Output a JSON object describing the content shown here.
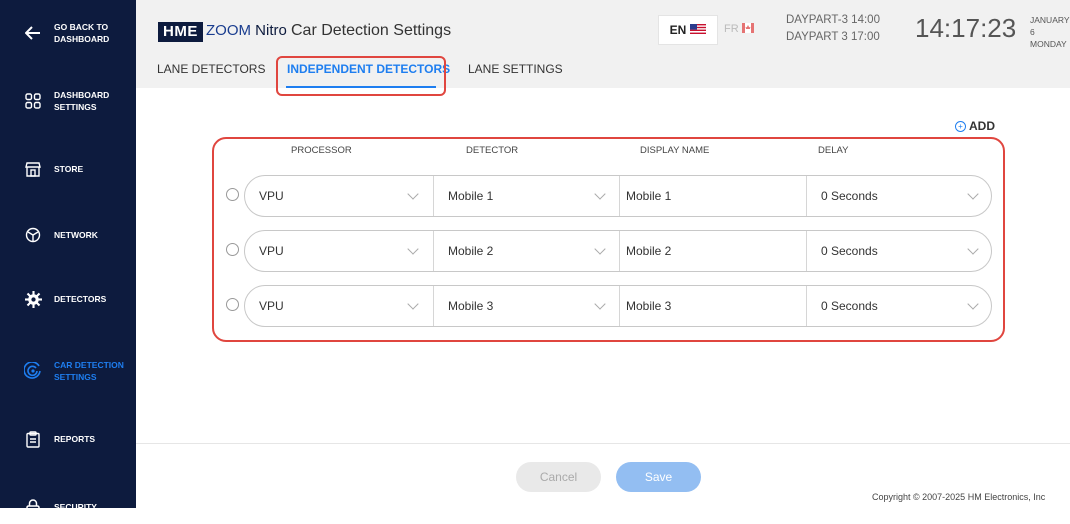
{
  "sidebar": {
    "items": [
      {
        "label": "GO BACK TO DASHBOARD",
        "icon": "arrow-left-icon"
      },
      {
        "label": "DASHBOARD SETTINGS",
        "icon": "dashboard-grid-icon"
      },
      {
        "label": "STORE",
        "icon": "store-icon"
      },
      {
        "label": "NETWORK",
        "icon": "network-icon"
      },
      {
        "label": "DETECTORS",
        "icon": "gear-icon"
      },
      {
        "label": "CAR DETECTION SETTINGS",
        "icon": "radar-icon"
      },
      {
        "label": "REPORTS",
        "icon": "clipboard-icon"
      },
      {
        "label": "SECURITY",
        "icon": "lock-icon"
      }
    ],
    "active_color": "#1e7ef0",
    "background": "#0d1b3e"
  },
  "header": {
    "logo_hme": "HME",
    "logo_zoom": "ZOOM",
    "logo_nitro": "Nitro",
    "page_title": "Car Detection Settings",
    "lang_en": "EN",
    "lang_fr": "FR",
    "daypart_line1": "DAYPART-3 14:00",
    "daypart_line2": "DAYPART 3 17:00",
    "clock": "14:17:23",
    "date_line1": "JANUARY 6",
    "date_line2": "MONDAY"
  },
  "tabs": [
    {
      "label": "LANE DETECTORS",
      "active": false
    },
    {
      "label": "INDEPENDENT DETECTORS",
      "active": true
    },
    {
      "label": "LANE SETTINGS",
      "active": false
    }
  ],
  "add_label": "ADD",
  "columns": [
    "PROCESSOR",
    "DETECTOR",
    "DISPLAY NAME",
    "DELAY"
  ],
  "rows": [
    {
      "processor": "VPU",
      "detector": "Mobile 1",
      "display_name": "Mobile 1",
      "delay": "0 Seconds"
    },
    {
      "processor": "VPU",
      "detector": "Mobile 2",
      "display_name": "Mobile 2",
      "delay": "0 Seconds"
    },
    {
      "processor": "VPU",
      "detector": "Mobile 3",
      "display_name": "Mobile 3",
      "delay": "0 Seconds"
    }
  ],
  "buttons": {
    "cancel": "Cancel",
    "save": "Save"
  },
  "copyright": "Copyright © 2007-2025 HM Electronics, Inc",
  "colors": {
    "accent": "#1e7ef0",
    "highlight": "#e0463f"
  }
}
